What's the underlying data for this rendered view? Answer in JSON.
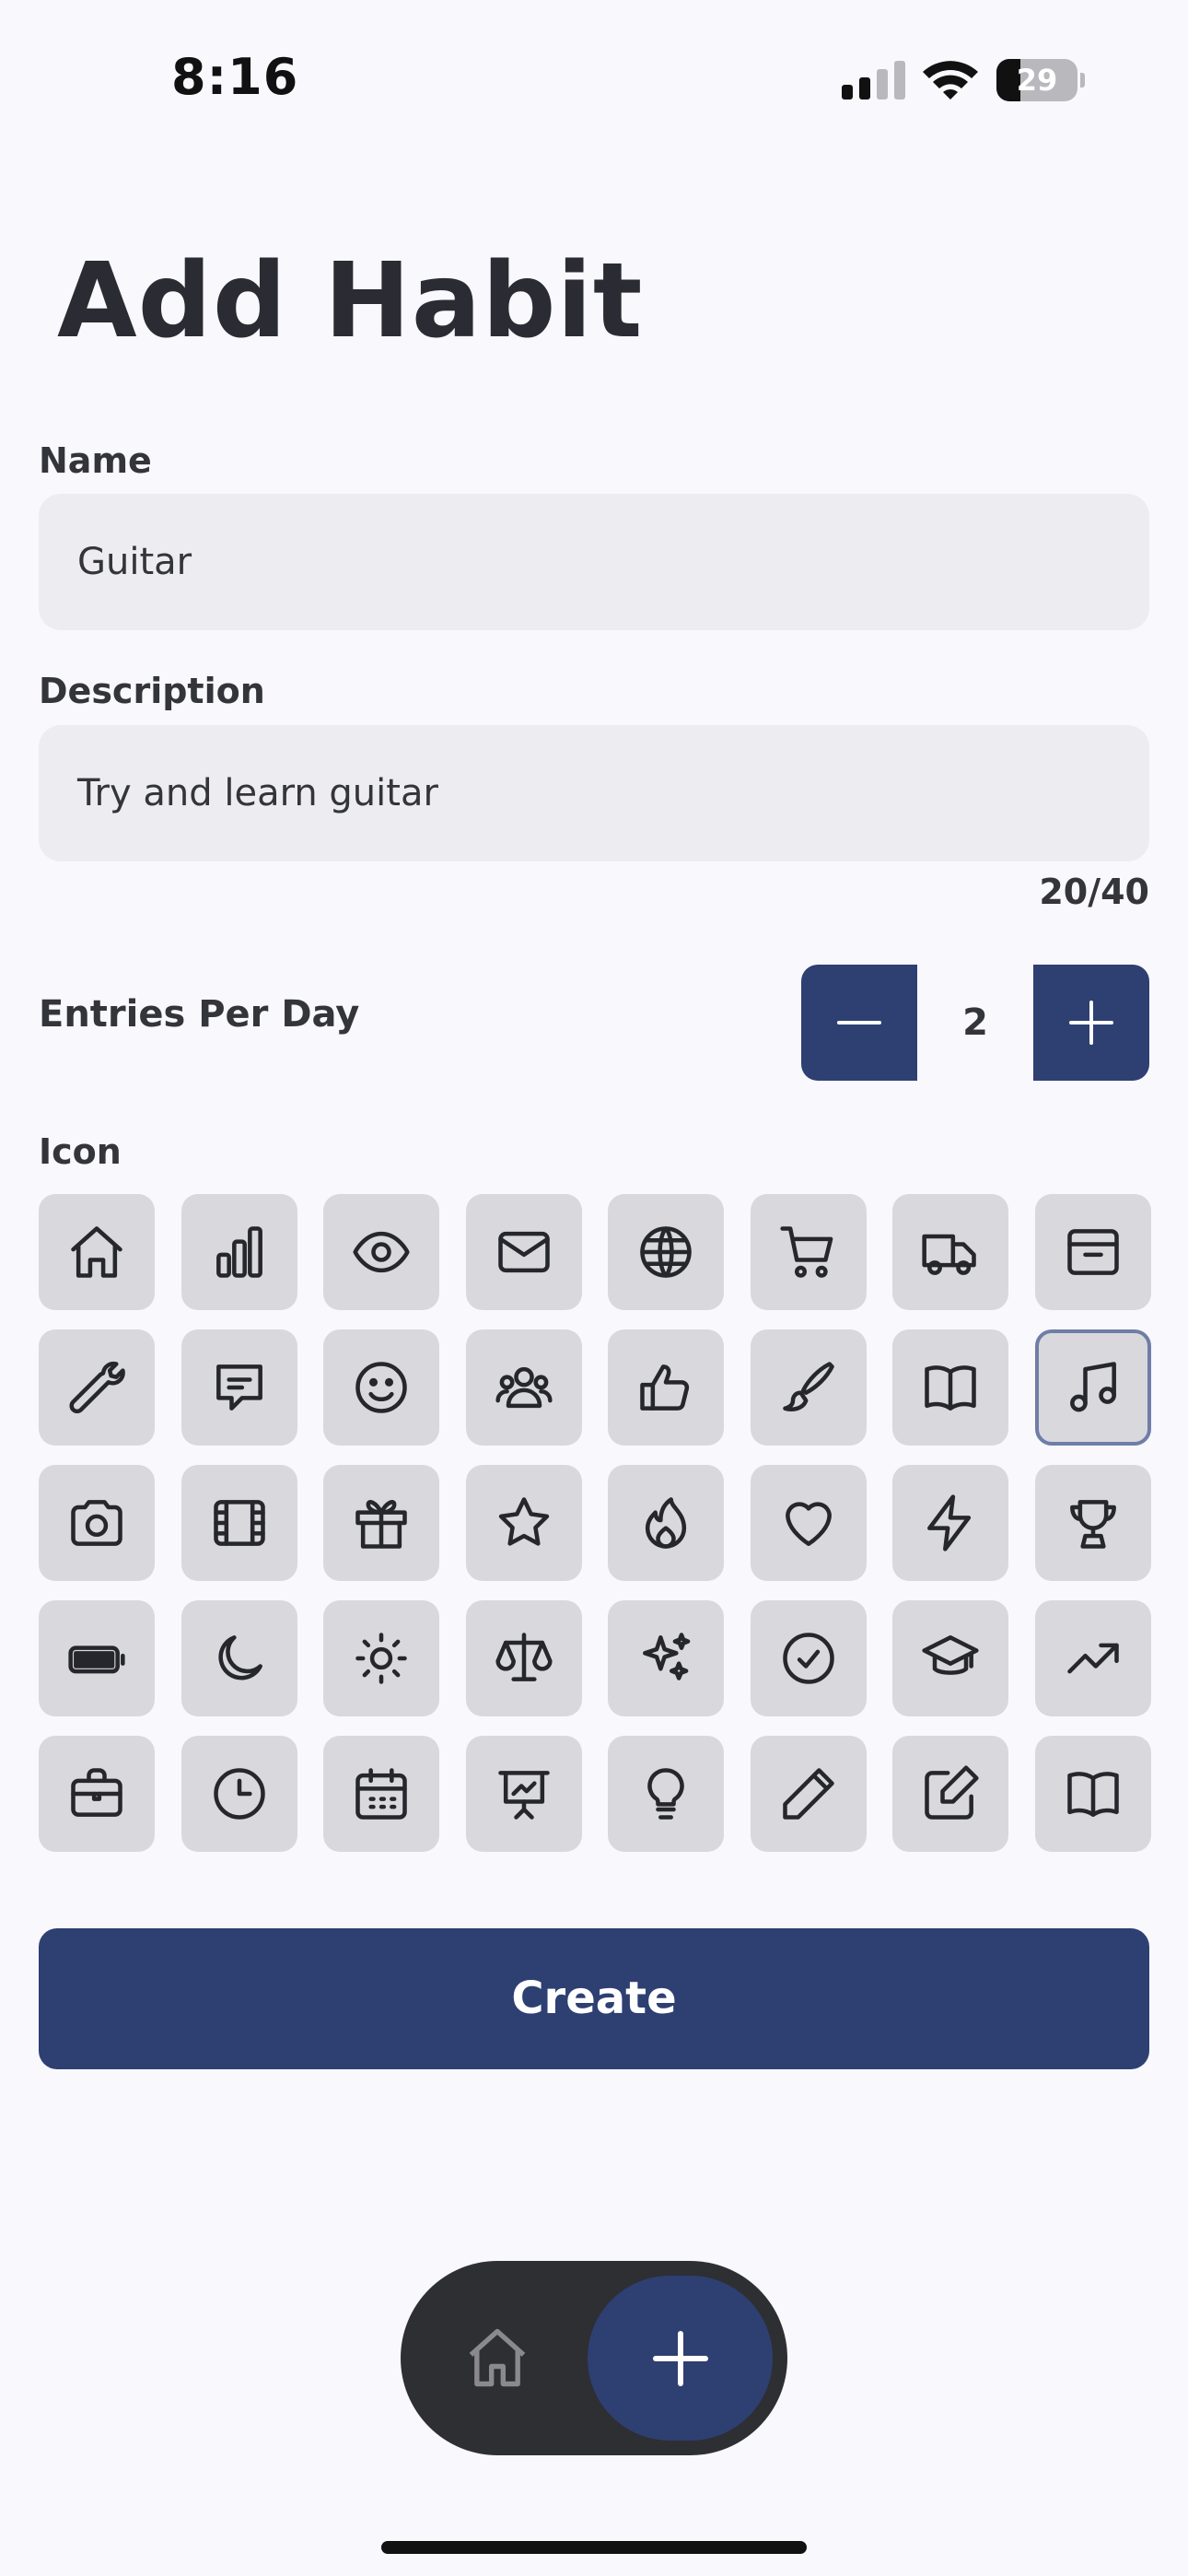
{
  "status_bar": {
    "time": "8:16",
    "battery": "29",
    "battery_level": 0.29
  },
  "title": "Add Habit",
  "form": {
    "name_label": "Name",
    "name_value": "Guitar",
    "description_label": "Description",
    "description_value": "Try and learn guitar",
    "description_counter": "20/40",
    "entries_label": "Entries Per Day",
    "entries_value": "2",
    "icon_label": "Icon",
    "selected_icon": "music-note-icon",
    "icons": [
      "house-icon",
      "bar-chart-icon",
      "eye-icon",
      "envelope-icon",
      "globe-icon",
      "shopping-cart-icon",
      "truck-icon",
      "archive-box-icon",
      "wrench-icon",
      "chat-bubble-icon",
      "face-smile-icon",
      "user-group-icon",
      "thumb-up-icon",
      "paint-brush-icon",
      "book-open-icon",
      "music-note-icon",
      "camera-icon",
      "film-icon",
      "gift-icon",
      "star-icon",
      "fire-icon",
      "heart-icon",
      "bolt-icon",
      "trophy-icon",
      "battery-icon",
      "moon-icon",
      "sun-icon",
      "scale-icon",
      "sparkles-icon",
      "check-circle-icon",
      "academic-cap-icon",
      "trending-up-icon",
      "briefcase-icon",
      "clock-icon",
      "calendar-icon",
      "presentation-chart-icon",
      "light-bulb-icon",
      "pencil-icon",
      "pencil-square-icon",
      "book-open-alt-icon"
    ],
    "create_label": "Create"
  },
  "colors": {
    "accent": "#2e3f72",
    "background": "#f8f8fd",
    "field": "#ececf1",
    "tile": "#d9d9dd",
    "tab_bar": "#2e2f33"
  }
}
